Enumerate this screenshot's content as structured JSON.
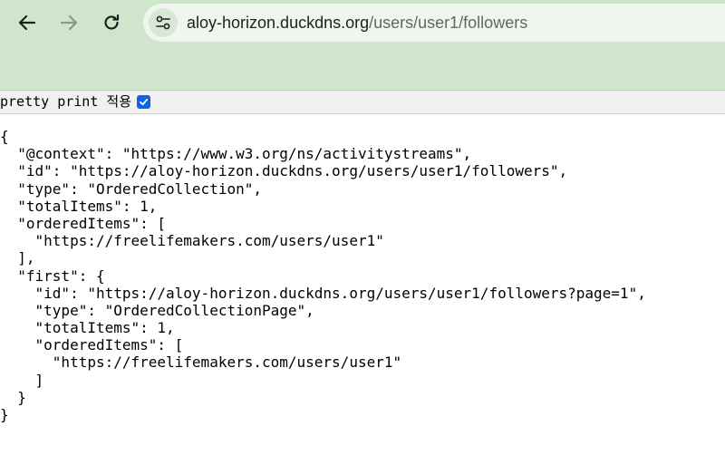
{
  "browser": {
    "url_host": "aloy-horizon.duckdns.org",
    "url_path": "/users/user1/followers",
    "icons": {
      "back": "arrow-left-icon",
      "forward": "arrow-right-icon",
      "reload": "reload-icon",
      "site_info": "tune-icon"
    },
    "colors": {
      "toolbar": "#cfe6cd",
      "omnibox": "#eef6ed"
    }
  },
  "pretty_print": {
    "label": "pretty print 적용",
    "checked": true,
    "check_color": "#0b63e5"
  },
  "json_lines": [
    "{",
    "  \"@context\": \"https://www.w3.org/ns/activitystreams\",",
    "  \"id\": \"https://aloy-horizon.duckdns.org/users/user1/followers\",",
    "  \"type\": \"OrderedCollection\",",
    "  \"totalItems\": 1,",
    "  \"orderedItems\": [",
    "    \"https://freelifemakers.com/users/user1\"",
    "  ],",
    "  \"first\": {",
    "    \"id\": \"https://aloy-horizon.duckdns.org/users/user1/followers?page=1\",",
    "    \"type\": \"OrderedCollectionPage\",",
    "    \"totalItems\": 1,",
    "    \"orderedItems\": [",
    "      \"https://freelifemakers.com/users/user1\"",
    "    ]",
    "  }",
    "}"
  ]
}
